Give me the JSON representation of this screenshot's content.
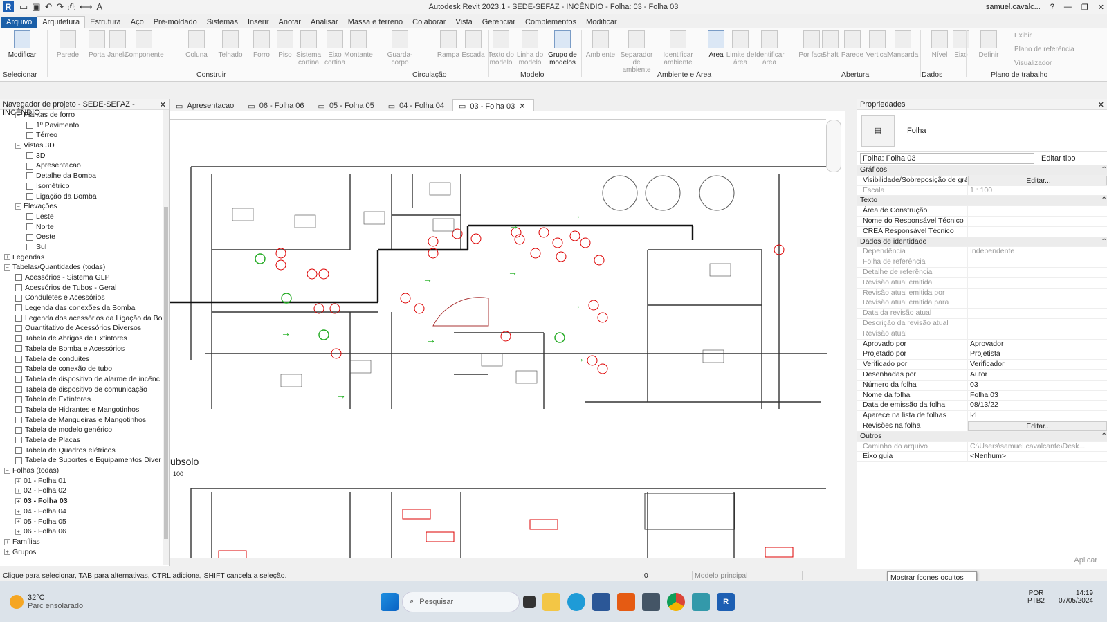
{
  "titlebar": {
    "title": "Autodesk Revit 2023.1 - SEDE-SEFAZ - INCÊNDIO - Folha: 03 - Folha 03",
    "user": "samuel.cavalc..."
  },
  "tabs": [
    "Arquivo",
    "Arquitetura",
    "Estrutura",
    "Aço",
    "Pré-moldado",
    "Sistemas",
    "Inserir",
    "Anotar",
    "Analisar",
    "Massa e terreno",
    "Colaborar",
    "Vista",
    "Gerenciar",
    "Complementos",
    "Modificar"
  ],
  "ribbon": {
    "buttons": [
      "Modificar",
      "Parede",
      "Porta",
      "Janela",
      "Componente",
      "Coluna",
      "Telhado",
      "Forro",
      "Piso",
      "Sistema cortina",
      "Eixo cortina",
      "Montante",
      "Guarda-corpo",
      "Rampa",
      "Escada",
      "Texto do modelo",
      "Linha do modelo",
      "Grupo de modelos",
      "Ambiente",
      "Separador de ambiente",
      "Identificar ambiente",
      "Área",
      "Limite de área",
      "Identificar área",
      "Por face",
      "Shaft",
      "Parede",
      "Vertical",
      "Mansarda",
      "Nível",
      "Eixo",
      "Definir"
    ],
    "small": [
      "Exibir",
      "Plano de referência",
      "Visualizador"
    ],
    "panels": [
      "Selecionar",
      "Construir",
      "Circulação",
      "Modelo",
      "Ambiente e Área",
      "Abertura",
      "Dados",
      "Plano de trabalho"
    ]
  },
  "browser": {
    "title": "Navegador de projeto - SEDE-SEFAZ - INCÊNDIO",
    "nodes": [
      {
        "t": "Plantas de forro",
        "l": 2,
        "tg": "−"
      },
      {
        "t": "1º Pavimento",
        "l": 4,
        "ico": 1
      },
      {
        "t": "Térreo",
        "l": 4,
        "ico": 1
      },
      {
        "t": "Vistas 3D",
        "l": 2,
        "tg": "−"
      },
      {
        "t": "3D",
        "l": 4,
        "ico": 1
      },
      {
        "t": "Apresentacao",
        "l": 4,
        "ico": 1
      },
      {
        "t": "Detalhe da Bomba",
        "l": 4,
        "ico": 1
      },
      {
        "t": "Isométrico",
        "l": 4,
        "ico": 1
      },
      {
        "t": "Ligação da Bomba",
        "l": 4,
        "ico": 1
      },
      {
        "t": "Elevações",
        "l": 2,
        "tg": "−"
      },
      {
        "t": "Leste",
        "l": 4,
        "ico": 1
      },
      {
        "t": "Norte",
        "l": 4,
        "ico": 1
      },
      {
        "t": "Oeste",
        "l": 4,
        "ico": 1
      },
      {
        "t": "Sul",
        "l": 4,
        "ico": 1
      },
      {
        "t": "Legendas",
        "l": 0,
        "tg": "+"
      },
      {
        "t": "Tabelas/Quantidades (todas)",
        "l": 0,
        "tg": "−"
      },
      {
        "t": "Acessórios - Sistema GLP",
        "l": 2,
        "ico": 1
      },
      {
        "t": "Acessórios de Tubos - Geral",
        "l": 2,
        "ico": 1
      },
      {
        "t": "Conduletes e Acessórios",
        "l": 2,
        "ico": 1
      },
      {
        "t": "Legenda das conexões da Bomba",
        "l": 2,
        "ico": 1
      },
      {
        "t": "Legenda dos acessórios da Ligação da Bo",
        "l": 2,
        "ico": 1
      },
      {
        "t": "Quantitativo de Acessórios Diversos",
        "l": 2,
        "ico": 1
      },
      {
        "t": "Tabela de Abrigos de Extintores",
        "l": 2,
        "ico": 1
      },
      {
        "t": "Tabela de Bomba e Acessórios",
        "l": 2,
        "ico": 1
      },
      {
        "t": "Tabela de conduites",
        "l": 2,
        "ico": 1
      },
      {
        "t": "Tabela de conexão de tubo",
        "l": 2,
        "ico": 1
      },
      {
        "t": "Tabela de dispositivo de alarme de incênc",
        "l": 2,
        "ico": 1
      },
      {
        "t": "Tabela de dispositivo de comunicação",
        "l": 2,
        "ico": 1
      },
      {
        "t": "Tabela de Extintores",
        "l": 2,
        "ico": 1
      },
      {
        "t": "Tabela de Hidrantes e Mangotinhos",
        "l": 2,
        "ico": 1
      },
      {
        "t": "Tabela de Mangueiras e Mangotinhos",
        "l": 2,
        "ico": 1
      },
      {
        "t": "Tabela de modelo genérico",
        "l": 2,
        "ico": 1
      },
      {
        "t": "Tabela de Placas",
        "l": 2,
        "ico": 1
      },
      {
        "t": "Tabela de Quadros elétricos",
        "l": 2,
        "ico": 1
      },
      {
        "t": "Tabela de Suportes e Equipamentos Diver",
        "l": 2,
        "ico": 1
      },
      {
        "t": "Folhas (todas)",
        "l": 0,
        "tg": "−"
      },
      {
        "t": "01 - Folha 01",
        "l": 2,
        "tg": "+"
      },
      {
        "t": "02 - Folha 02",
        "l": 2,
        "tg": "+"
      },
      {
        "t": "03 - Folha 03",
        "l": 2,
        "tg": "+",
        "sel": 1
      },
      {
        "t": "04 - Folha 04",
        "l": 2,
        "tg": "+"
      },
      {
        "t": "05 - Folha 05",
        "l": 2,
        "tg": "+"
      },
      {
        "t": "06 - Folha 06",
        "l": 2,
        "tg": "+"
      },
      {
        "t": "Famílias",
        "l": 0,
        "tg": "+"
      },
      {
        "t": "Grupos",
        "l": 0,
        "tg": "+"
      }
    ]
  },
  "doctabs": [
    "Apresentacao",
    "06 - Folha 06",
    "05 - Folha 05",
    "04 - Folha 04",
    "03 - Folha 03"
  ],
  "canvas": {
    "view_label": "ubsolo",
    "scale": "100"
  },
  "props": {
    "title": "Propriedades",
    "type": "Folha",
    "selector": "Folha: Folha 03",
    "edit_type": "Editar tipo",
    "rows": [
      {
        "g": "Gráficos"
      },
      {
        "k": "Visibilidade/Sobreposição de gráf...",
        "v": "Editar...",
        "btn": 1
      },
      {
        "k": "Escala",
        "v": "1 : 100",
        "grey": 1
      },
      {
        "g": "Texto"
      },
      {
        "k": "Área de Construção",
        "v": ""
      },
      {
        "k": "Nome do Responsável Técnico",
        "v": ""
      },
      {
        "k": "CREA Responsável Técnico",
        "v": ""
      },
      {
        "g": "Dados de identidade"
      },
      {
        "k": "Dependência",
        "v": "Independente",
        "grey": 1
      },
      {
        "k": "Folha de referência",
        "v": "",
        "grey": 1
      },
      {
        "k": "Detalhe de referência",
        "v": "",
        "grey": 1
      },
      {
        "k": "Revisão atual emitida",
        "v": "",
        "grey": 1
      },
      {
        "k": "Revisão atual emitida por",
        "v": "",
        "grey": 1
      },
      {
        "k": "Revisão atual emitida para",
        "v": "",
        "grey": 1
      },
      {
        "k": "Data da revisão atual",
        "v": "",
        "grey": 1
      },
      {
        "k": "Descrição da revisão atual",
        "v": "",
        "grey": 1
      },
      {
        "k": "Revisão atual",
        "v": "",
        "grey": 1
      },
      {
        "k": "Aprovado por",
        "v": "Aprovador"
      },
      {
        "k": "Projetado por",
        "v": "Projetista"
      },
      {
        "k": "Verificado por",
        "v": "Verificador"
      },
      {
        "k": "Desenhadas por",
        "v": "Autor"
      },
      {
        "k": "Número da folha",
        "v": "03"
      },
      {
        "k": "Nome da folha",
        "v": "Folha 03"
      },
      {
        "k": "Data de emissão da folha",
        "v": "08/13/22"
      },
      {
        "k": "Aparece na lista de folhas",
        "v": "☑"
      },
      {
        "k": "Revisões na folha",
        "v": "Editar...",
        "btn": 1
      },
      {
        "g": "Outros"
      },
      {
        "k": "Caminho do arquivo",
        "v": "C:\\Users\\samuel.cavalcante\\Desk...",
        "grey": 1
      },
      {
        "k": "Eixo guia",
        "v": "<Nenhum>"
      }
    ],
    "apply": "Aplicar"
  },
  "status": {
    "text": "Clique para selecionar, TAB para alternativas, CTRL adiciona, SHIFT cancela a seleção.",
    "model": "Modelo principal",
    "zero": ":0"
  },
  "tooltip": "Mostrar ícones ocultos",
  "taskbar": {
    "temp": "32°C",
    "weather": "Parc ensolarado",
    "search": "Pesquisar",
    "lang1": "POR",
    "lang2": "PTB2",
    "time": "14:19",
    "date": "07/05/2024"
  }
}
